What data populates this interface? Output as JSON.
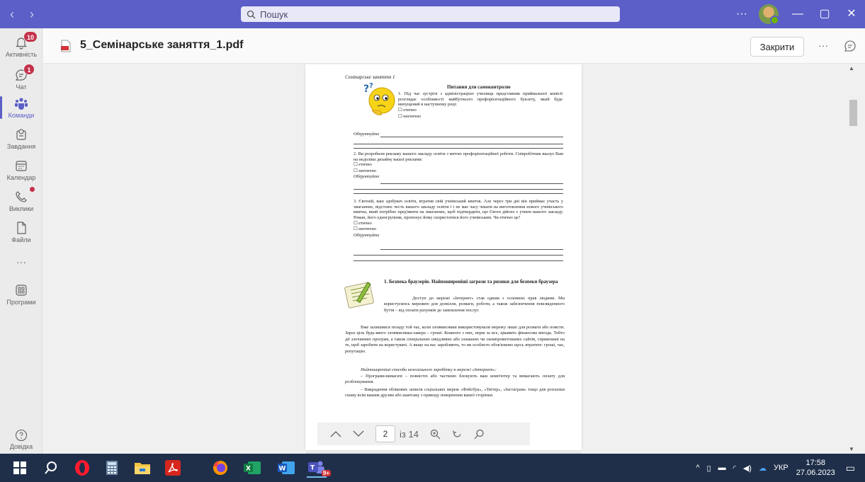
{
  "titlebar": {
    "search_placeholder": "Пошук",
    "more": "···",
    "minimize": "—",
    "maximize": "▢",
    "close": "✕"
  },
  "rail": {
    "activity": {
      "label": "Активність",
      "badge": "10"
    },
    "chat": {
      "label": "Чат",
      "badge": "1"
    },
    "teams": {
      "label": "Команди"
    },
    "assignments": {
      "label": "Завдання"
    },
    "calendar": {
      "label": "Календар"
    },
    "calls": {
      "label": "Виклики"
    },
    "files": {
      "label": "Файли"
    },
    "more": {
      "label": "···"
    },
    "apps": {
      "label": "Програми"
    },
    "help": {
      "label": "Довідка"
    }
  },
  "header": {
    "file_name": "5_Семінарське заняття_1.pdf",
    "close_label": "Закрити",
    "more": "···"
  },
  "document": {
    "running_header": "Семінарське заняття 1",
    "section_title": "Питання для самоконтролю",
    "q1": "1. Під час зустрічі з адміністрацією училища представник приймальної комісії розглядає особливості майбутнього профорієнтаційного буклету, який буде випущений в наступному році:",
    "opt_ethical": "☐ етично",
    "opt_unethical": "☐ неетично",
    "justify": "Обґрунтуйте",
    "q2": "2. Ви розробили рекламу вашого закладу освіти з метою профорієнтаційної роботи. Співробітник вказує Вам на недоліки дизайну вашої реклами:",
    "q3": "3. Євгеній, ваш здобувач освіти, втратив свій учнівський квиток. Але через три дні він приймає участь у змаганнях, відстоює честь вашого закладу освіти і і не має часу чекати на виготовлення нового учнівського квитка, який потрібно пред'явити на змаганнях, щоб підтвердити, що Євген дійсно є учнем вашого закладу. Роман, його одногрупник, пропонує йому скористатися його учнівським. Чи етично це?",
    "s1_title": "1. Безпека браузерів. Найпоширеніші загрози та ризики для безпеки браузера",
    "p1": "Доступ до мережі «Інтернет» став одним з основних прав людини. Ми користуємось мережею для дозвілля, розваги, роботи, а також забезпечення повсякденного буття – від оплати рахунків до замовлення послуг.",
    "p2": "Вже залишився позаду той час, коли зловмисники використовували мережу лише для розваги або помсти. Зараз ціль будь-якого зловмисника-хакера – гроші. Кожного з них, перш за все, цікавить фінансова вигода. Тобто дії злочинних програм, а також спеціальних шкідливих або зламаних чи скомпрометованих сайтів, спрямовані на те, щоб заробити на користувачі. А якщо на вас заробляють, то ви особисто обов'язково щось втратите: гроші, час, репутацію.",
    "p3": "Найпоширеніші способи нелегального заробітку в мережі «Інтернет»:",
    "p4": "– Програми-вимагачі – повністю або частково блокують ваш комп'ютер та вимагають оплату для розблокування.",
    "p5": "– Викрадення облікових записів соціальних мереж «Фейсбук», «Твітер», «Інстаграм» тощо для розсилки спаму всім вашим друзям або шантажу з приводу повернення вашої сторінки."
  },
  "pdf_toolbar": {
    "page": "2",
    "of_pages": "із 14"
  },
  "taskbar": {
    "lang": "УКР",
    "time": "17:58",
    "date": "27.06.2023",
    "teams_badge": "9+"
  }
}
